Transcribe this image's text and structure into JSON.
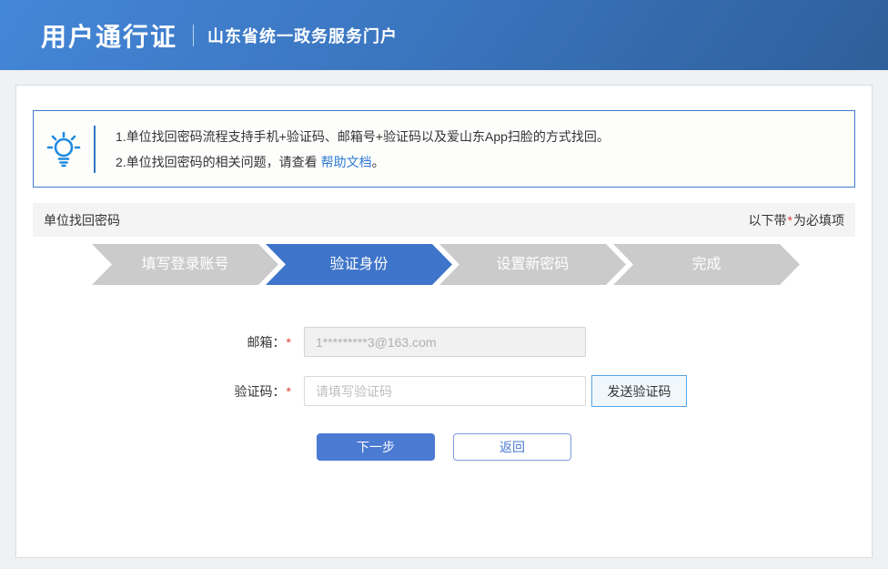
{
  "header": {
    "title": "用户通行证",
    "subtitle": "山东省统一政务服务门户"
  },
  "notice": {
    "line1": "1.单位找回密码流程支持手机+验证码、邮箱号+验证码以及爱山东App扫脸的方式找回。",
    "line2_prefix": "2.单位找回密码的相关问题，请查看 ",
    "line2_link": "帮助文档",
    "line2_suffix": "。"
  },
  "section": {
    "title": "单位找回密码",
    "required_prefix": "以下带",
    "required_star": "*",
    "required_suffix": "为必填项"
  },
  "steps": [
    {
      "label": "填写登录账号",
      "state": "done"
    },
    {
      "label": "验证身份",
      "state": "active"
    },
    {
      "label": "设置新密码",
      "state": "pending"
    },
    {
      "label": "完成",
      "state": "pending"
    }
  ],
  "form": {
    "email_label": "邮箱：",
    "email_required": "*",
    "email_value": "1*********3@163.com",
    "code_label": "验证码：",
    "code_required": "*",
    "code_placeholder": "请填写验证码",
    "send_code_button": "发送验证码",
    "next_button": "下一步",
    "back_button": "返回"
  },
  "colors": {
    "accent_blue": "#3e74c9",
    "link_blue": "#2f7bd4",
    "step_inactive_gray": "#cbcbcb",
    "required_red": "#e23c3c",
    "notice_border_blue": "#3f7ecb",
    "send_button_border": "#56a4e2"
  }
}
